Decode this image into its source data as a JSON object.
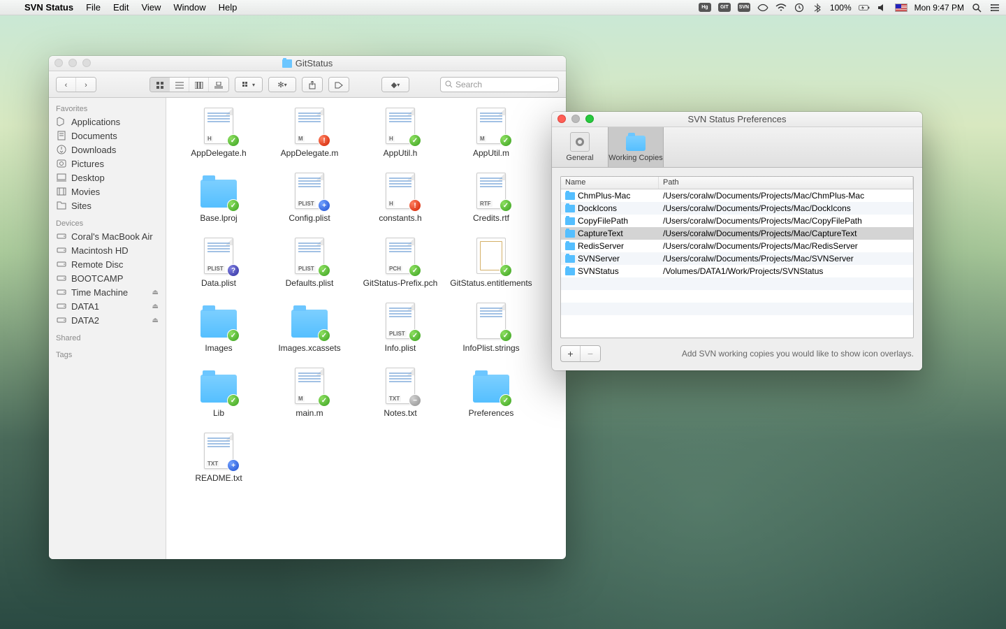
{
  "menubar": {
    "app": "SVN Status",
    "items": [
      "File",
      "Edit",
      "View",
      "Window",
      "Help"
    ],
    "battery_pct": "100%",
    "clock": "Mon 9:47 PM"
  },
  "finder": {
    "title": "GitStatus",
    "search_placeholder": "Search",
    "sidebar": {
      "favorites_label": "Favorites",
      "favorites": [
        {
          "label": "Applications",
          "icon": "⌘"
        },
        {
          "label": "Documents",
          "icon": "📄"
        },
        {
          "label": "Downloads",
          "icon": "⬇"
        },
        {
          "label": "Pictures",
          "icon": "📷"
        },
        {
          "label": "Desktop",
          "icon": "🖥"
        },
        {
          "label": "Movies",
          "icon": "🎞"
        },
        {
          "label": "Sites",
          "icon": "📁"
        }
      ],
      "devices_label": "Devices",
      "devices": [
        {
          "label": "Coral's MacBook Air",
          "icon": "💻",
          "eject": false
        },
        {
          "label": "Macintosh HD",
          "icon": "💽",
          "eject": false
        },
        {
          "label": "Remote Disc",
          "icon": "💿",
          "eject": false
        },
        {
          "label": "BOOTCAMP",
          "icon": "💽",
          "eject": false
        },
        {
          "label": "Time Machine",
          "icon": "💽",
          "eject": true
        },
        {
          "label": "DATA1",
          "icon": "💽",
          "eject": true
        },
        {
          "label": "DATA2",
          "icon": "💽",
          "eject": true
        }
      ],
      "shared_label": "Shared",
      "tags_label": "Tags"
    },
    "files": [
      {
        "name": "AppDelegate.h",
        "type": "doc",
        "tag": "H",
        "badge": "ok"
      },
      {
        "name": "AppDelegate.m",
        "type": "doc",
        "tag": "M",
        "badge": "err"
      },
      {
        "name": "AppUtil.h",
        "type": "doc",
        "tag": "H",
        "badge": "ok"
      },
      {
        "name": "AppUtil.m",
        "type": "doc",
        "tag": "M",
        "badge": "ok"
      },
      {
        "name": "Base.lproj",
        "type": "folder",
        "badge": "ok"
      },
      {
        "name": "Config.plist",
        "type": "doc",
        "tag": "PLIST",
        "badge": "add"
      },
      {
        "name": "constants.h",
        "type": "doc",
        "tag": "H",
        "badge": "err"
      },
      {
        "name": "Credits.rtf",
        "type": "doc",
        "tag": "RTF",
        "badge": "ok"
      },
      {
        "name": "Data.plist",
        "type": "doc",
        "tag": "PLIST",
        "badge": "q"
      },
      {
        "name": "Defaults.plist",
        "type": "doc",
        "tag": "PLIST",
        "badge": "ok"
      },
      {
        "name": "GitStatus-Prefix.pch",
        "type": "doc",
        "tag": "PCH",
        "badge": "ok"
      },
      {
        "name": "GitStatus.entitlements",
        "type": "cert",
        "badge": "ok"
      },
      {
        "name": "Images",
        "type": "folder",
        "badge": "ok"
      },
      {
        "name": "Images.xcassets",
        "type": "folder",
        "badge": "ok"
      },
      {
        "name": "Info.plist",
        "type": "doc",
        "tag": "PLIST",
        "badge": "ok"
      },
      {
        "name": "InfoPlist.strings",
        "type": "doc",
        "tag": "",
        "badge": "ok"
      },
      {
        "name": "Lib",
        "type": "folder",
        "badge": "ok"
      },
      {
        "name": "main.m",
        "type": "doc",
        "tag": "M",
        "badge": "ok"
      },
      {
        "name": "Notes.txt",
        "type": "doc",
        "tag": "TXT",
        "badge": "ign"
      },
      {
        "name": "Preferences",
        "type": "folder",
        "badge": "ok"
      },
      {
        "name": "README.txt",
        "type": "doc",
        "tag": "TXT",
        "badge": "add"
      }
    ]
  },
  "prefs": {
    "title": "SVN Status Preferences",
    "tabs": {
      "general": "General",
      "wc": "Working Copies"
    },
    "columns": {
      "name": "Name",
      "path": "Path"
    },
    "rows": [
      {
        "name": "ChmPlus-Mac",
        "path": "/Users/coralw/Documents/Projects/Mac/ChmPlus-Mac"
      },
      {
        "name": "DockIcons",
        "path": "/Users/coralw/Documents/Projects/Mac/DockIcons"
      },
      {
        "name": "CopyFilePath",
        "path": "/Users/coralw/Documents/Projects/Mac/CopyFilePath"
      },
      {
        "name": "CaptureText",
        "path": "/Users/coralw/Documents/Projects/Mac/CaptureText",
        "selected": true
      },
      {
        "name": "RedisServer",
        "path": "/Users/coralw/Documents/Projects/Mac/RedisServer"
      },
      {
        "name": "SVNServer",
        "path": "/Users/coralw/Documents/Projects/Mac/SVNServer"
      },
      {
        "name": "SVNStatus",
        "path": "/Volumes/DATA1/Work/Projects/SVNStatus"
      }
    ],
    "hint": "Add SVN working copies you would like to show icon overlays.",
    "add": "+",
    "remove": "−"
  }
}
